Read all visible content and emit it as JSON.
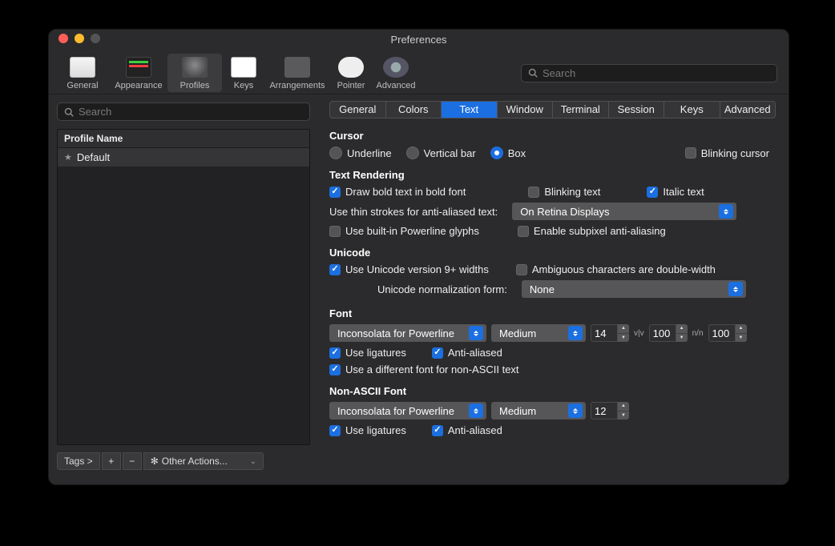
{
  "window": {
    "title": "Preferences"
  },
  "toolbar": {
    "items": [
      {
        "label": "General"
      },
      {
        "label": "Appearance"
      },
      {
        "label": "Profiles"
      },
      {
        "label": "Keys"
      },
      {
        "label": "Arrangements"
      },
      {
        "label": "Pointer"
      },
      {
        "label": "Advanced"
      }
    ],
    "search_placeholder": "Search"
  },
  "sidebar": {
    "search_placeholder": "Search",
    "header": "Profile Name",
    "rows": [
      "Default"
    ],
    "tags_label": "Tags >",
    "other_actions": "Other Actions..."
  },
  "tabs": [
    "General",
    "Colors",
    "Text",
    "Window",
    "Terminal",
    "Session",
    "Keys",
    "Advanced"
  ],
  "active_tab": "Text",
  "cursor": {
    "heading": "Cursor",
    "underline": "Underline",
    "vertical": "Vertical bar",
    "box": "Box",
    "blinking": "Blinking cursor"
  },
  "rendering": {
    "heading": "Text Rendering",
    "bold": "Draw bold text in bold font",
    "blinking": "Blinking text",
    "italic": "Italic text",
    "thin_label": "Use thin strokes for anti-aliased text:",
    "thin_value": "On Retina Displays",
    "powerline": "Use built-in Powerline glyphs",
    "subpixel": "Enable subpixel anti-aliasing"
  },
  "unicode": {
    "heading": "Unicode",
    "v9": "Use Unicode version 9+ widths",
    "ambiguous": "Ambiguous characters are double-width",
    "norm_label": "Unicode normalization form:",
    "norm_value": "None"
  },
  "font": {
    "heading": "Font",
    "family": "Inconsolata for Powerline",
    "weight": "Medium",
    "size": "14",
    "hspace": "100",
    "vspace": "100",
    "ligatures": "Use ligatures",
    "aa": "Anti-aliased",
    "diff": "Use a different font for non-ASCII text"
  },
  "nonascii": {
    "heading": "Non-ASCII Font",
    "family": "Inconsolata for Powerline",
    "weight": "Medium",
    "size": "12",
    "ligatures": "Use ligatures",
    "aa": "Anti-aliased"
  }
}
